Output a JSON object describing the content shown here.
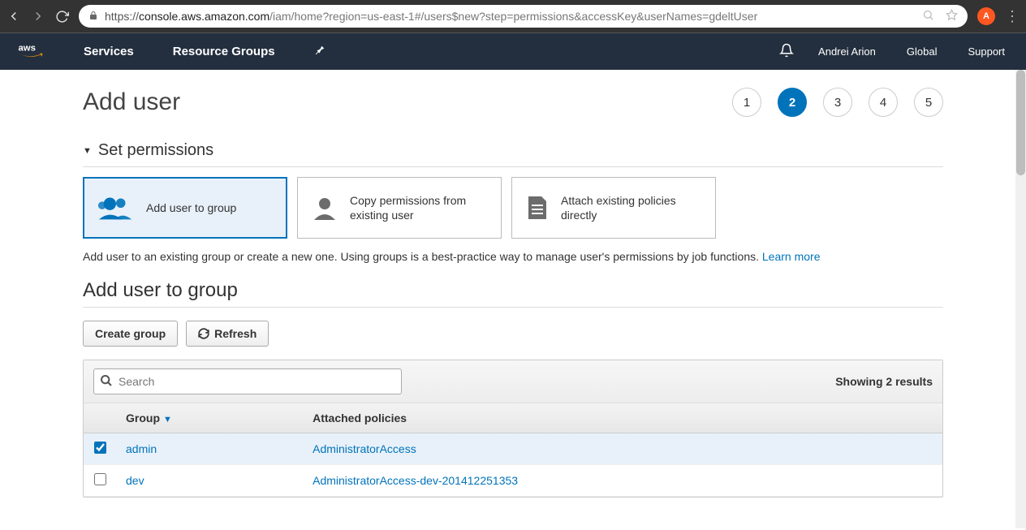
{
  "browser": {
    "url_domain": "console.aws.amazon.com",
    "url_path": "/iam/home?region=us-east-1#/users$new?step=permissions&accessKey&userNames=gdeltUser",
    "url_prefix": "https://",
    "profile_letter": "A"
  },
  "nav": {
    "services": "Services",
    "resource_groups": "Resource Groups",
    "user": "Andrei Arion",
    "region": "Global",
    "support": "Support"
  },
  "page": {
    "title": "Add user",
    "steps": [
      "1",
      "2",
      "3",
      "4",
      "5"
    ],
    "active_step": 2,
    "section_title": "Set permissions",
    "cards": {
      "add_to_group": "Add user to group",
      "copy_existing": "Copy permissions from existing user",
      "attach_policies": "Attach existing policies directly"
    },
    "helper_text": "Add user to an existing group or create a new one. Using groups is a best-practice way to manage user's permissions by job functions. ",
    "learn_more": "Learn more",
    "subtitle": "Add user to group",
    "create_group_btn": "Create group",
    "refresh_btn": "Refresh",
    "search_placeholder": "Search",
    "results_text": "Showing 2 results",
    "col_group": "Group",
    "col_policies": "Attached policies",
    "rows": [
      {
        "checked": true,
        "group": "admin",
        "policies": "AdministratorAccess"
      },
      {
        "checked": false,
        "group": "dev",
        "policies": "AdministratorAccess-dev-201412251353"
      }
    ]
  }
}
